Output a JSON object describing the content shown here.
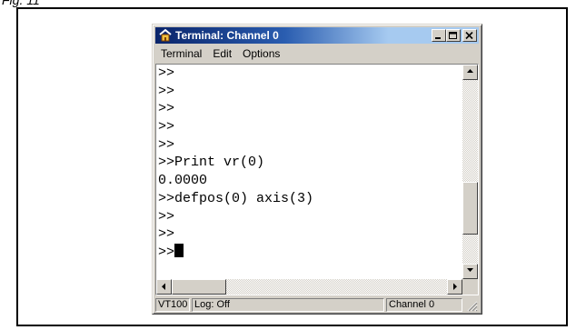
{
  "caption": "Fig. 11",
  "window": {
    "title": "Terminal: Channel 0",
    "caption_buttons": [
      "minimize",
      "maximize",
      "close"
    ]
  },
  "menu": [
    {
      "label": "Terminal"
    },
    {
      "label": "Edit"
    },
    {
      "label": "Options"
    }
  ],
  "terminal": {
    "lines": [
      ">>",
      ">>",
      ">>",
      ">>",
      ">>",
      ">>Print vr(0)",
      "0.0000",
      ">>defpos(0) axis(3)",
      ">>",
      ">>",
      ">>"
    ],
    "cursor_line": 10
  },
  "scrollbars": {
    "vertical_position": 0.78,
    "horizontal_position": 0.0
  },
  "status": {
    "mode": "VT100",
    "log": "Log: Off",
    "channel": "Channel 0"
  },
  "colors": {
    "titlebar_start": "#0a246a",
    "titlebar_end": "#a6caf0",
    "face": "#d4d0c8"
  }
}
